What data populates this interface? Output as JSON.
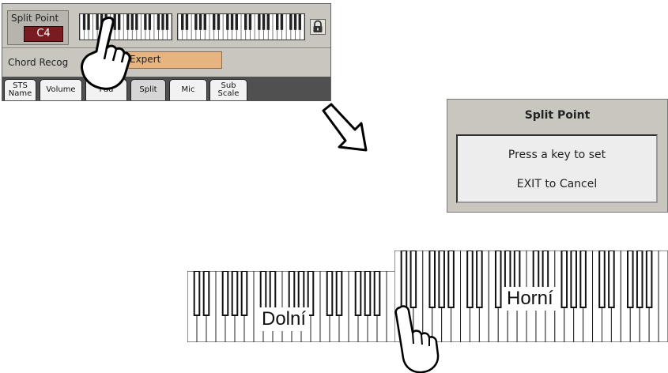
{
  "panel": {
    "split_point_label": "Split Point",
    "split_point_value": "C4",
    "chord_recognition_label": "Chord Recog",
    "chord_recognition_value": "Expert",
    "tabs": [
      {
        "label": "STS\nName"
      },
      {
        "label": "Volume"
      },
      {
        "label": "Pad"
      },
      {
        "label": "Split"
      },
      {
        "label": "Mic"
      },
      {
        "label": "Sub\nScale"
      }
    ],
    "icons": [
      "lock-icon",
      "pointing-hand-icon"
    ]
  },
  "dialog": {
    "title": "Split Point",
    "line1": "Press a key to set",
    "line2": "EXIT to Cancel"
  },
  "keyboard": {
    "lower_label": "Dolní",
    "upper_label": "Horní"
  },
  "colors": {
    "panel_bg": "#c9c6bf",
    "split_value_bg": "#7a1c1f",
    "chord_field_bg": "#e7b47f",
    "tab_bar_bg": "#505050"
  }
}
